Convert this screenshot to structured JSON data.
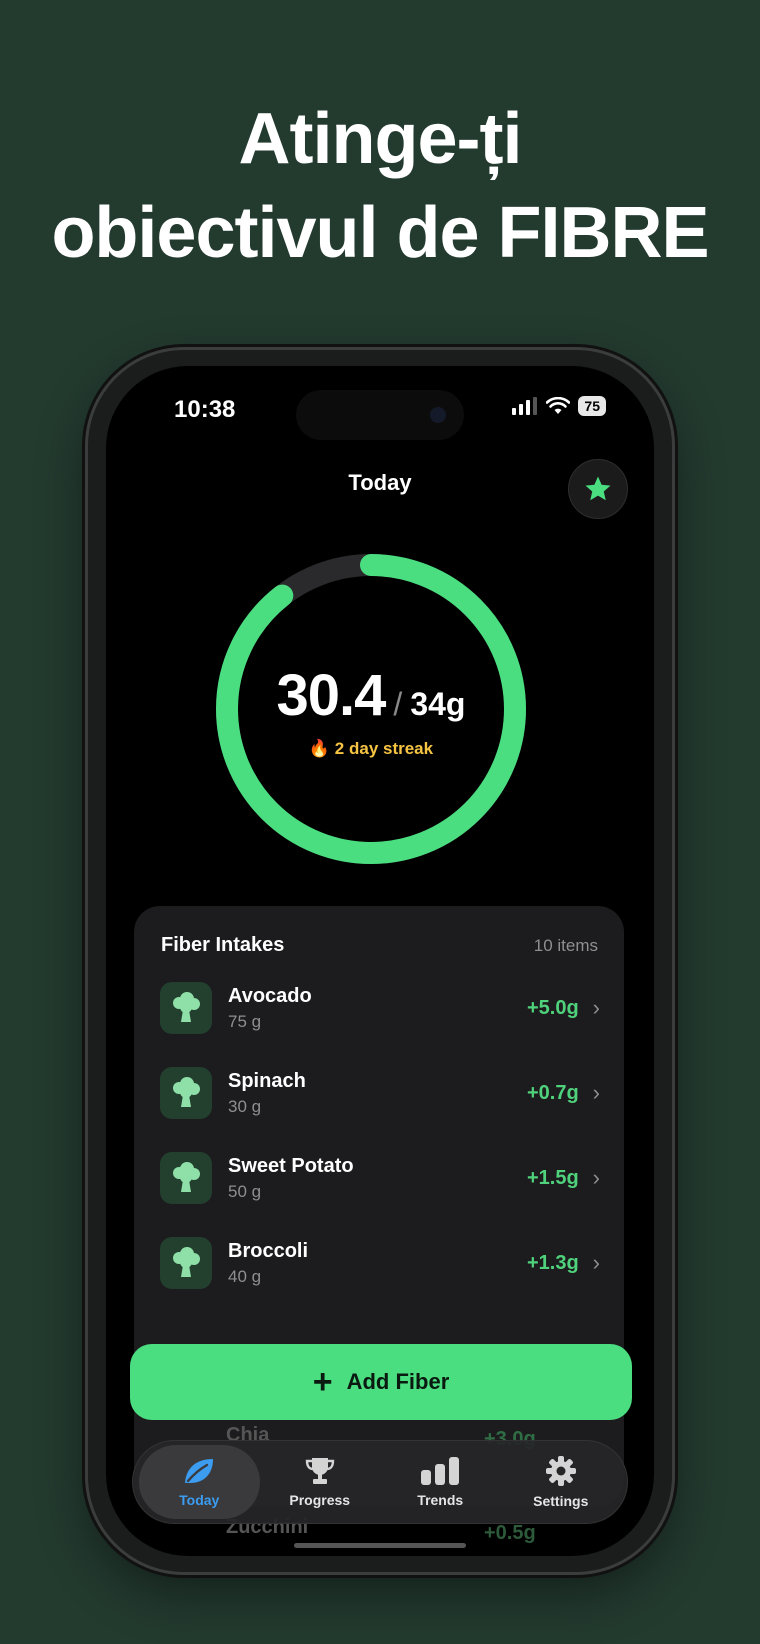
{
  "headline": {
    "line1": "Atinge-ți",
    "line2": "obiectivul de FIBRE"
  },
  "status": {
    "time": "10:38",
    "battery": "75"
  },
  "header": {
    "title": "Today"
  },
  "ring": {
    "current": "30.4",
    "slash": "/",
    "goal": "34g",
    "progress": 0.894,
    "streak_icon": "🔥",
    "streak": "2 day streak"
  },
  "intakes": {
    "title": "Fiber Intakes",
    "count": "10 items",
    "items": [
      {
        "name": "Avocado",
        "amount": "75 g",
        "fiber": "+5.0g"
      },
      {
        "name": "Spinach",
        "amount": "30 g",
        "fiber": "+0.7g"
      },
      {
        "name": "Sweet Potato",
        "amount": "50 g",
        "fiber": "+1.5g"
      },
      {
        "name": "Broccoli",
        "amount": "40 g",
        "fiber": "+1.3g"
      }
    ],
    "partial_items": [
      {
        "name": "Chia",
        "fiber": "+3.0g"
      },
      {
        "name": "Zucchini",
        "fiber": "+0.5g"
      }
    ]
  },
  "add_button": {
    "icon": "plus-icon",
    "label": "Add Fiber"
  },
  "tabs": [
    {
      "label": "Today",
      "icon": "leaf-icon",
      "active": true
    },
    {
      "label": "Progress",
      "icon": "trophy-icon",
      "active": false
    },
    {
      "label": "Trends",
      "icon": "bar-chart-icon",
      "active": false
    },
    {
      "label": "Settings",
      "icon": "gear-icon",
      "active": false
    }
  ],
  "colors": {
    "background": "#233a2f",
    "accent": "#4ade80",
    "streak": "#f6c343",
    "tab_active": "#3b9cf0"
  }
}
